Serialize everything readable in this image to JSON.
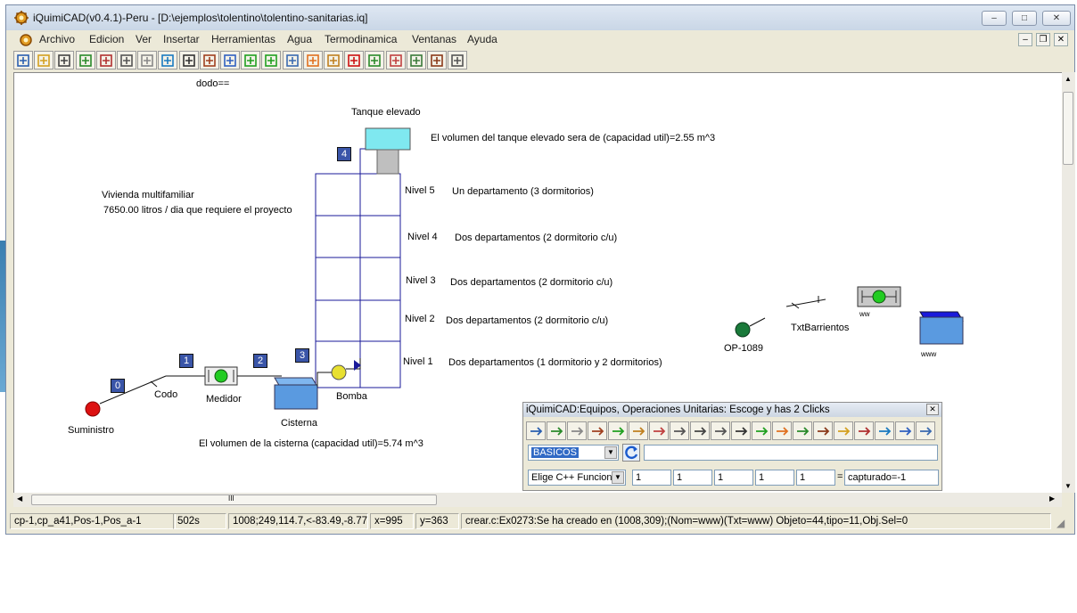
{
  "window": {
    "title": "iQuimiCAD(v0.4.1)-Peru - [D:\\ejemplos\\tolentino\\tolentino-sanitarias.iq]",
    "btn_minimize": "–",
    "btn_maximize": "□",
    "btn_close": "✕"
  },
  "menu": [
    "Archivo",
    "Edicion",
    "Ver",
    "Insertar",
    "Herramientas",
    "Agua",
    "Termodinamica",
    "Ventanas",
    "Ayuda"
  ],
  "mdi": {
    "minimize": "–",
    "restore": "❐",
    "close": "✕"
  },
  "toolbar_icons": [
    "new-icon",
    "open-icon",
    "save-icon",
    "grid-icon",
    "chart-icon",
    "copy-icon",
    "paste-icon",
    "help-icon",
    "mirror-icon",
    "align-icon",
    "route-icon",
    "run-icon",
    "pause-icon",
    "network-icon",
    "color-palette-icon",
    "pencil-icon",
    "delete-icon",
    "timer-icon",
    "mountain-icon",
    "image-icon",
    "photo-icon",
    "print-icon"
  ],
  "diagram": {
    "dodo": "dodo==",
    "tank_title": "Tanque elevado",
    "tank_volume": "El volumen del tanque elevado sera de (capacidad util)=2.55 m^3",
    "vivienda": "Vivienda multifamiliar",
    "litros": "7650.00 litros / dia que requiere el proyecto",
    "levels": [
      {
        "name": "Nivel 5",
        "desc": "Un departamento (3 dormitorios)"
      },
      {
        "name": "Nivel 4",
        "desc": "Dos departamentos (2 dormitorio c/u)"
      },
      {
        "name": "Nivel 3",
        "desc": "Dos departamentos (2 dormitorio c/u)"
      },
      {
        "name": "Nivel 2",
        "desc": "Dos departamentos (2 dormitorio c/u)"
      },
      {
        "name": "Nivel 1",
        "desc": "Dos departamentos (1 dormitorio y 2 dormitorios)"
      }
    ],
    "node_labels": [
      "0",
      "1",
      "2",
      "3",
      "4"
    ],
    "suministro": "Suministro",
    "codo": "Codo",
    "medidor": "Medidor",
    "cisterna": "Cisterna",
    "bomba": "Bomba",
    "cisterna_volume": "El volumen de la cisterna (capacidad util)=5.74 m^3",
    "op": "OP-1089",
    "txt_barrientos": "TxtBarrientos",
    "www_small": "ww",
    "www": "www",
    "colors": {
      "node_box": "#3a55a8",
      "tank": "#7fe8f0",
      "cisterna": "#5a9ae0",
      "pump": "#e8e030",
      "meter": "#22cc22",
      "suministro": "#dd1111",
      "op": "#1a7a3a",
      "building_line": "#1a1a99"
    }
  },
  "palette": {
    "title": "iQuimiCAD:Equipos, Operaciones Unitarias: Escoge y has 2 Clicks",
    "close": "✕",
    "category": "BASICOS",
    "function_select": "Elige C++ Funcion",
    "params": [
      "1",
      "1",
      "1",
      "1",
      "1"
    ],
    "equals": "=",
    "result": "capturado=-1",
    "icons": [
      "arrow-left-icon",
      "stair-icon",
      "arrow-right-green-icon",
      "column-icon",
      "arrow-red-icon",
      "arrow-green-icon",
      "valve-icon",
      "bowtie-icon",
      "x-valve-icon",
      "dot-icon",
      "tex-icon",
      "battery-icon",
      "split-icon",
      "mixer-icon",
      "splitter-icon",
      "tee-icon",
      "monitor-icon",
      "funnel-icon",
      "flask-icon",
      "pause-bars-icon"
    ]
  },
  "status": {
    "p1": "cp-1,cp_a41,Pos-1,Pos_a-1",
    "p2": "502s",
    "p3": "1008;249,114.7,<-83.49,-8.77",
    "p4": "x=995",
    "p5": "y=363",
    "p6": "crear.c:Ex0273:Se ha creado en (1008,309);(Nom=www)(Txt=www) Objeto=44,tipo=11,Obj.Sel=0"
  },
  "hscroll_thumb_label": "III"
}
